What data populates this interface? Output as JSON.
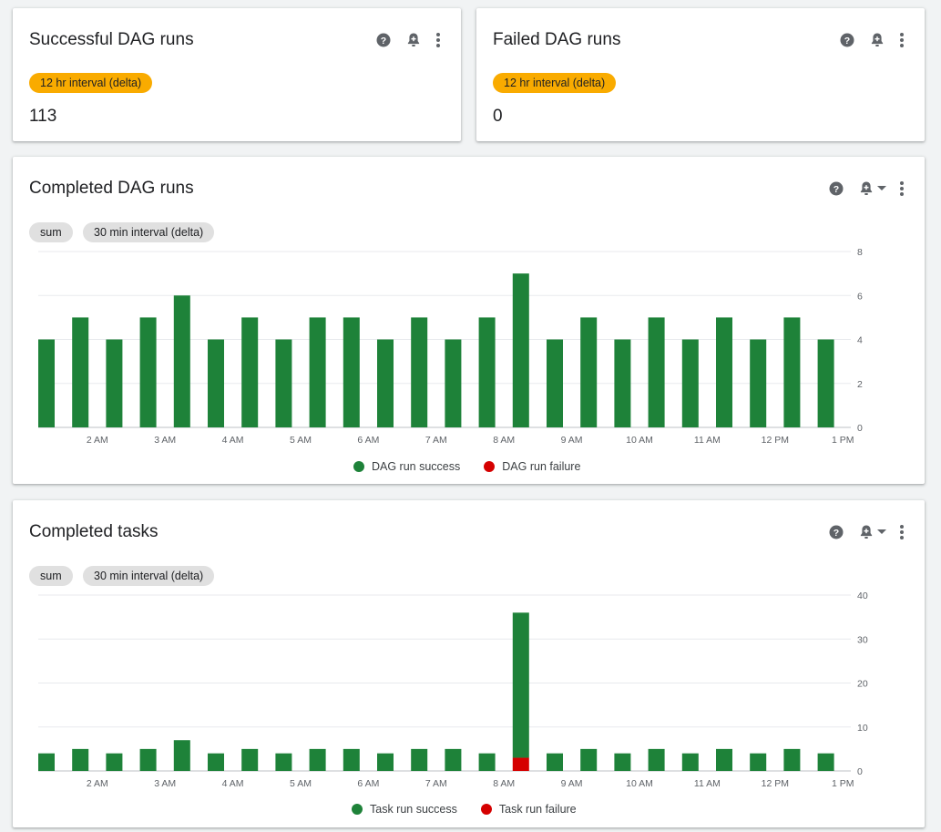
{
  "cards": {
    "successful": {
      "title": "Successful DAG runs",
      "chip": "12 hr interval (delta)",
      "value": "113"
    },
    "failed": {
      "title": "Failed DAG runs",
      "chip": "12 hr interval (delta)",
      "value": "0"
    },
    "completed_dag": {
      "title": "Completed DAG runs",
      "chips": [
        "sum",
        "30 min interval (delta)"
      ],
      "legend": [
        "DAG run success",
        "DAG run failure"
      ]
    },
    "completed_tasks": {
      "title": "Completed tasks",
      "chips": [
        "sum",
        "30 min interval (delta)"
      ],
      "legend": [
        "Task run success",
        "Task run failure"
      ]
    }
  },
  "colors": {
    "success": "#1e8239",
    "failure": "#d50000",
    "chip_orange": "#f9ab00",
    "chip_grey": "#e0e0e0"
  },
  "icons": [
    "help-icon",
    "add-alert-icon",
    "more-vert-icon",
    "dropdown-arrow-icon"
  ],
  "chart_data": [
    {
      "type": "bar",
      "stacked": true,
      "x_ticks": [
        "2 AM",
        "3 AM",
        "4 AM",
        "5 AM",
        "6 AM",
        "7 AM",
        "8 AM",
        "9 AM",
        "10 AM",
        "11 AM",
        "12 PM",
        "1 PM"
      ],
      "y_ticks": [
        0,
        2,
        4,
        6,
        8
      ],
      "ylim": [
        0,
        8
      ],
      "grid": true,
      "legend_position": "bottom",
      "series": [
        {
          "name": "DAG run success",
          "values": [
            4,
            5,
            4,
            5,
            6,
            4,
            5,
            4,
            5,
            5,
            4,
            5,
            4,
            5,
            7,
            4,
            5,
            4,
            5,
            4,
            5,
            4,
            5,
            4
          ]
        },
        {
          "name": "DAG run failure",
          "values": [
            0,
            0,
            0,
            0,
            0,
            0,
            0,
            0,
            0,
            0,
            0,
            0,
            0,
            0,
            0,
            0,
            0,
            0,
            0,
            0,
            0,
            0,
            0,
            0
          ]
        }
      ]
    },
    {
      "type": "bar",
      "stacked": true,
      "x_ticks": [
        "2 AM",
        "3 AM",
        "4 AM",
        "5 AM",
        "6 AM",
        "7 AM",
        "8 AM",
        "9 AM",
        "10 AM",
        "11 AM",
        "12 PM",
        "1 PM"
      ],
      "y_ticks": [
        0,
        10,
        20,
        30,
        40
      ],
      "ylim": [
        0,
        40
      ],
      "grid": true,
      "legend_position": "bottom",
      "series": [
        {
          "name": "Task run success",
          "values": [
            4,
            5,
            4,
            5,
            7,
            4,
            5,
            4,
            5,
            5,
            4,
            5,
            5,
            4,
            33,
            4,
            5,
            4,
            5,
            4,
            5,
            4,
            5,
            4
          ]
        },
        {
          "name": "Task run failure",
          "values": [
            0,
            0,
            0,
            0,
            0,
            0,
            0,
            0,
            0,
            0,
            0,
            0,
            0,
            0,
            3,
            0,
            0,
            0,
            0,
            0,
            0,
            0,
            0,
            0
          ]
        }
      ]
    }
  ]
}
